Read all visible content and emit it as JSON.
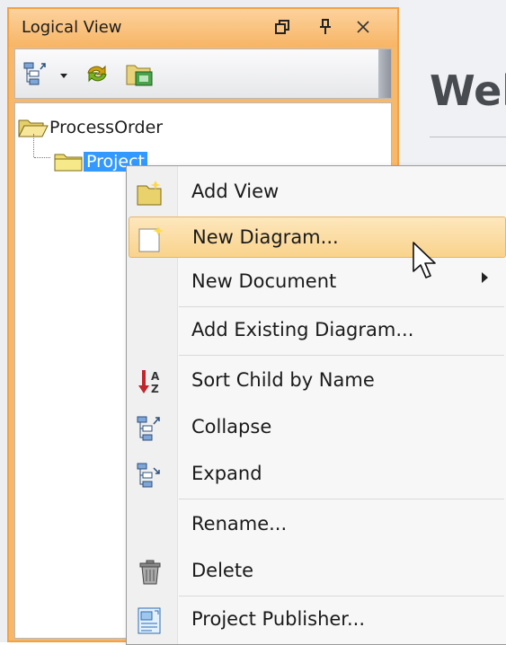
{
  "panel": {
    "title": "Logical View",
    "header_buttons": [
      "restore-icon",
      "pin-icon",
      "close-icon"
    ]
  },
  "toolbar": {
    "icons": [
      "collapse-tree-icon",
      "dropdown-arrow-icon",
      "refresh-icon",
      "folder-filter-icon"
    ]
  },
  "tree": {
    "root": {
      "label": "ProcessOrder",
      "icon": "open-folder-icon"
    },
    "child": {
      "label": "Project",
      "icon": "folder-icon",
      "selected": true
    }
  },
  "welcome": {
    "title": "Wel"
  },
  "context_menu": {
    "items": [
      {
        "label": "Add View",
        "icon": "add-view-icon"
      },
      {
        "label": "New Diagram...",
        "icon": "new-diagram-icon",
        "highlighted": true
      },
      {
        "label": "New Document",
        "icon": "",
        "has_submenu": true
      },
      {
        "label": "Add Existing Diagram...",
        "icon": ""
      },
      {
        "label": "Sort Child by Name",
        "icon": "sort-icon"
      },
      {
        "label": "Collapse",
        "icon": "collapse-icon"
      },
      {
        "label": "Expand",
        "icon": "expand-icon"
      },
      {
        "label": "Rename...",
        "icon": ""
      },
      {
        "label": "Delete",
        "icon": "trash-icon"
      },
      {
        "label": "Project Publisher...",
        "icon": "publisher-icon"
      }
    ]
  },
  "colors": {
    "panel_header": "#f7b566",
    "selection": "#3399ff",
    "menu_highlight": "#f9d38c"
  }
}
